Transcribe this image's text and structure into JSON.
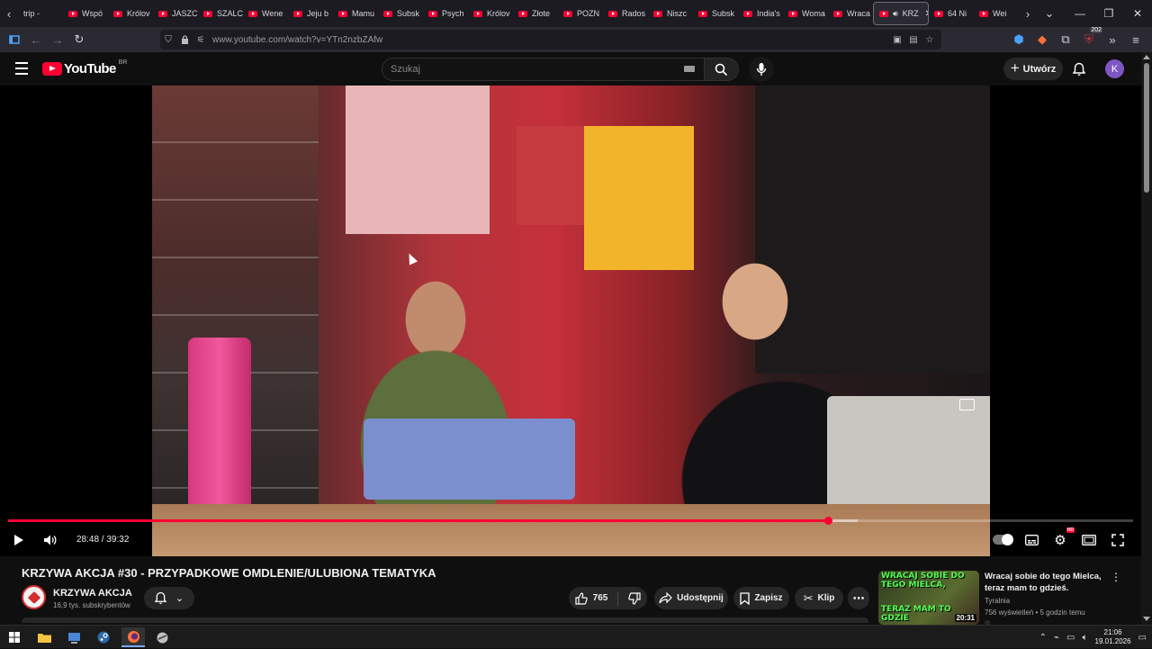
{
  "browser": {
    "tabs": [
      {
        "label": "trip - ",
        "yt": false
      },
      {
        "label": "Wspó",
        "yt": true
      },
      {
        "label": "Królov",
        "yt": true
      },
      {
        "label": "JASZC",
        "yt": true
      },
      {
        "label": "SZALC",
        "yt": true
      },
      {
        "label": "Wene",
        "yt": true
      },
      {
        "label": "Jeju b",
        "yt": true
      },
      {
        "label": "Mamu",
        "yt": true
      },
      {
        "label": "Subsk",
        "yt": true
      },
      {
        "label": "Psych",
        "yt": true
      },
      {
        "label": "Królov",
        "yt": true
      },
      {
        "label": "Złote",
        "yt": true
      },
      {
        "label": "POZN",
        "yt": true
      },
      {
        "label": "Rados",
        "yt": true
      },
      {
        "label": "Niszc",
        "yt": true
      },
      {
        "label": "Subsk",
        "yt": true
      },
      {
        "label": "India's",
        "yt": true
      },
      {
        "label": "Woma",
        "yt": true
      },
      {
        "label": "Wraca",
        "yt": true
      }
    ],
    "active_tab": {
      "label": "KRZ"
    },
    "tabs_after": [
      {
        "label": "64 Ni",
        "yt": true
      },
      {
        "label": "Wei",
        "yt": true
      }
    ],
    "url": "www.youtube.com/watch?v=YTn2nzbZAfw",
    "extension_badge": "202"
  },
  "youtube": {
    "logo_text": "YouTube",
    "country_code": "BR",
    "search_placeholder": "Szukaj",
    "create_label": "Utwórz",
    "avatar_letter": "K"
  },
  "player": {
    "time_current": "28:48",
    "time_total": "39:32",
    "time_display": "28:48 / 39:32",
    "progress_fraction": 0.7285,
    "buffer_fraction": 0.755,
    "settings_badge": "HD"
  },
  "video": {
    "title": "KRZYWA AKCJA #30 - PRZYPADKOWE OMDLENIE/ULUBIONA TEMATYKA",
    "channel": "KRZYWA AKCJA",
    "subscribers": "16,9 tys. subskrybentów",
    "likes": "765",
    "share_label": "Udostępnij",
    "save_label": "Zapisz",
    "clip_label": "Klip"
  },
  "recommendation": {
    "title": "Wracaj sobie do tego Mielca, teraz mam to gdzieś.",
    "channel": "Tyralnia",
    "meta": "756 wyświetleń • 5 godzin temu",
    "duration": "20:31",
    "thumb_text_top": "WRACAJ SOBIE DO TEGO MIELCA,",
    "thumb_text_bottom": "TERAZ MAM TO GDZIE"
  },
  "taskbar": {
    "time": "21:06",
    "date": "19.01.2026"
  }
}
